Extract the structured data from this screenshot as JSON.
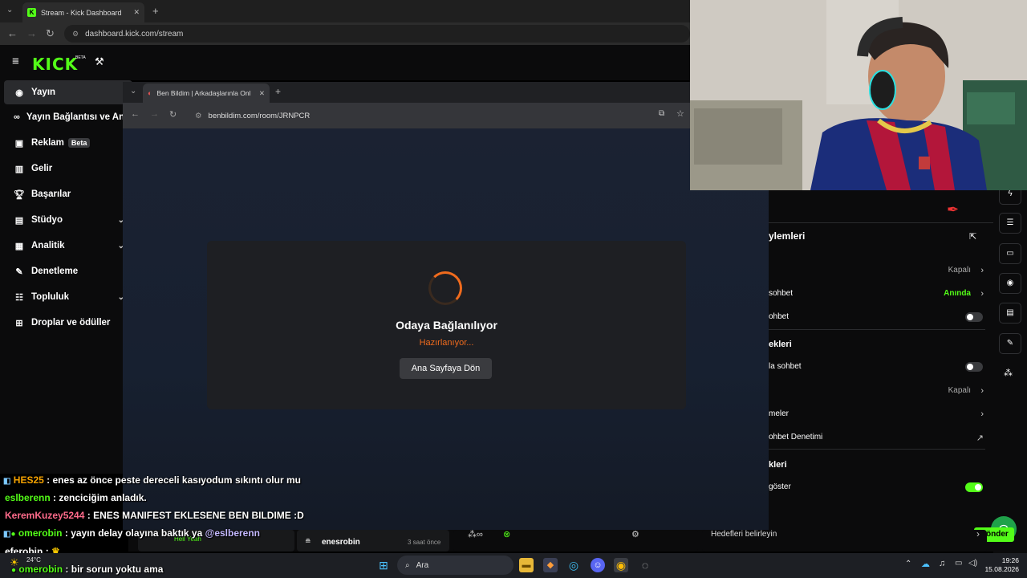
{
  "outer_browser": {
    "tab_title": "Stream - Kick Dashboard",
    "url": "dashboard.kick.com/stream"
  },
  "kick": {
    "logo": "KICK",
    "logo_badge": "BETA"
  },
  "sidebar": {
    "items": [
      {
        "label": "Yayın",
        "icon": "broadcast-icon"
      },
      {
        "label": "Yayın Bağlantısı ve Anahtarı",
        "icon": "link-icon"
      },
      {
        "label": "Reklam",
        "badge": "Beta",
        "icon": "ad-icon"
      },
      {
        "label": "Gelir",
        "icon": "chart-icon"
      },
      {
        "label": "Başarılar",
        "icon": "trophy-icon"
      },
      {
        "label": "Stüdyo",
        "icon": "studio-icon"
      },
      {
        "label": "Analitik",
        "icon": "analytics-icon"
      },
      {
        "label": "Denetleme",
        "icon": "wrench-icon"
      },
      {
        "label": "Topluluk",
        "icon": "community-icon"
      },
      {
        "label": "Droplar ve ödüller",
        "icon": "gift-icon"
      }
    ]
  },
  "inner_browser": {
    "tab_title": "Ben Bildim | Arkadaşlarınla Online",
    "url": "benbildim.com/room/JRNPCR"
  },
  "modal": {
    "title": "Odaya Bağlanılıyor",
    "status": "Hazırlanıyor...",
    "home_button": "Ana Sayfaya Dön"
  },
  "settings_panel": {
    "header": "ylemleri",
    "row1_value": "Kapalı",
    "row2_label": "sohbet",
    "row2_value": "Anında",
    "row3_label": "ohbet",
    "section2": "ekleri",
    "row4_label": "la sohbet",
    "row5_value": "Kapalı",
    "row6_label": "meler",
    "row7_label": "ohbet Denetimi",
    "section3": "kleri",
    "row8_label": "göster",
    "goals_label": "Hedefleri belirleyin"
  },
  "bottom_strip": {
    "username": "enesrobin",
    "time": "3 saat önce",
    "send_button": "Gönder",
    "hell_yeah": "Hell Yeah"
  },
  "chat": [
    {
      "user": "HES25",
      "text": ": enes az önce peste dereceli kasıyodum sıkıntı olur mu"
    },
    {
      "user": "eslberenn",
      "text": ": zenciciğim anladık."
    },
    {
      "user": "KeremKuzey5244",
      "text": ": ENES MANIFEST EKLESENE BEN BILDIME :D"
    },
    {
      "user": "omerobin",
      "text": ": yayın delay olayına baktık ya",
      "mention": "@eslberenn"
    },
    {
      "user": "eferobin",
      "text": ":"
    },
    {
      "user": "omerobin",
      "text": ": bir sorun yoktu ama"
    }
  ],
  "taskbar": {
    "weather": "24°C",
    "search_placeholder": "Ara",
    "time": "19:26",
    "date": "15.08.2026"
  },
  "colors": {
    "kick_green": "#53fc18",
    "orange": "#f06b1d",
    "panel_bg": "#0b0b0c"
  }
}
